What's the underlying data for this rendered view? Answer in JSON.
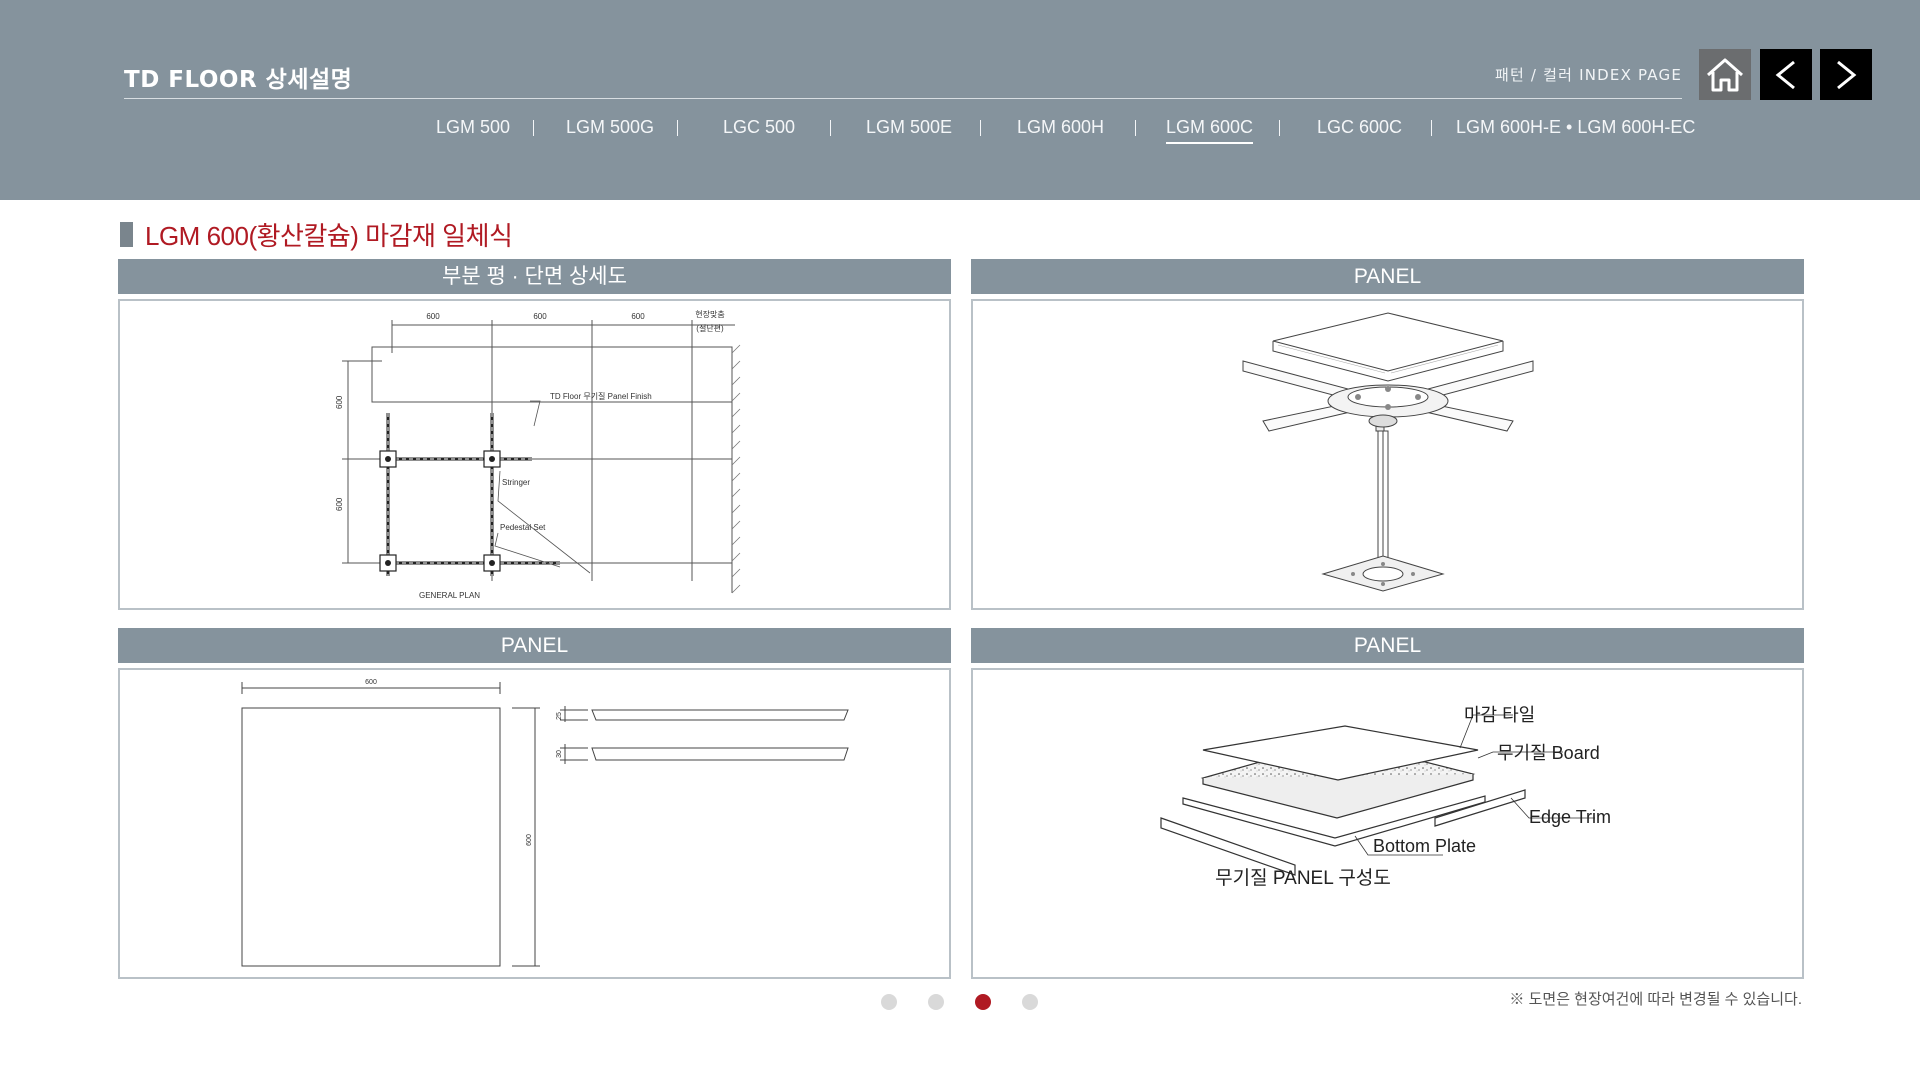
{
  "header": {
    "brand": "TD FLOOR 상세설명",
    "index_link": "패턴 / 컬러 INDEX PAGE",
    "icons": {
      "home": "home-icon",
      "prev": "chevron-left-icon",
      "next": "chevron-right-icon"
    },
    "tabs": [
      {
        "label": "LGM 500",
        "active": false
      },
      {
        "label": "LGM 500G",
        "active": false
      },
      {
        "label": "LGC 500",
        "active": false
      },
      {
        "label": "LGM 500E",
        "active": false
      },
      {
        "label": "LGM 600H",
        "active": false
      },
      {
        "label": "LGM 600C",
        "active": true
      },
      {
        "label": "LGC 600C",
        "active": false
      },
      {
        "label": "LGM 600H-E • LGM 600H-EC",
        "active": false
      }
    ]
  },
  "section": {
    "title": "LGM 600(황산칼슘) 마감재 일체식"
  },
  "panels": {
    "plan": {
      "heading": "부분 평 · 단면 상세도",
      "dims": [
        "600",
        "600",
        "600",
        "600",
        "600"
      ],
      "site_label": "현장맞춤",
      "site_sub": "(절단편)",
      "finish_label": "TD Floor 무기질 Panel Finish",
      "stringer_label": "Stringer",
      "pedestal_label": "Pedestal Set",
      "caption": "GENERAL PLAN"
    },
    "iso": {
      "heading": "PANEL"
    },
    "dims": {
      "heading": "PANEL",
      "width": "600",
      "height": "600",
      "thick1": "25",
      "thick2": "30"
    },
    "layers": {
      "heading": "PANEL",
      "label_tile": "마감 타일",
      "label_board": "무기질 Board",
      "label_trim": "Edge Trim",
      "label_plate": "Bottom Plate",
      "caption": "무기질 PANEL 구성도"
    }
  },
  "pagination": {
    "total": 4,
    "current": 3
  },
  "footnote": "※ 도면은 현장여건에 따라 변경될 수 있습니다.",
  "colors": {
    "header_bg": "#85939d",
    "accent_red": "#b01a23",
    "dot_inactive": "#d9d9d9"
  }
}
